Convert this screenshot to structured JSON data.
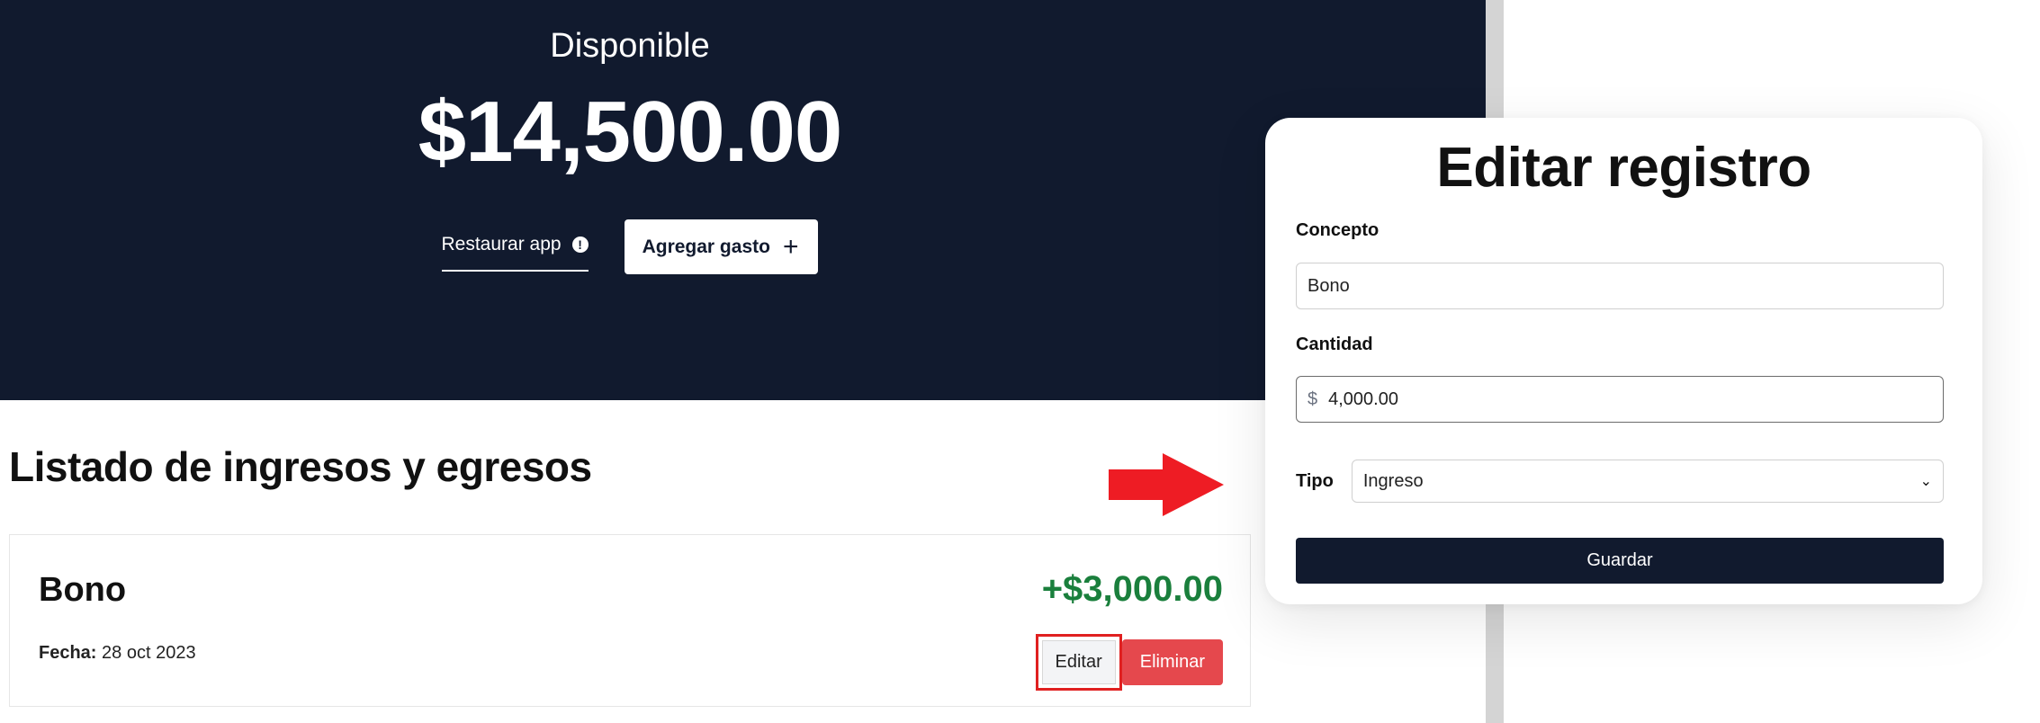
{
  "hero": {
    "label": "Disponible",
    "amount": "$14,500.00",
    "restore_label": "Restaurar app",
    "add_label": "Agregar gasto",
    "icons": {
      "restore": "alert-circle-icon",
      "add": "plus-icon"
    }
  },
  "list": {
    "title": "Listado de ingresos y egresos",
    "records": [
      {
        "concept": "Bono",
        "amount": "+$3,000.00",
        "date_label": "Fecha:",
        "date_value": "28 oct 2023",
        "edit_label": "Editar",
        "delete_label": "Eliminar"
      }
    ]
  },
  "modal": {
    "title": "Editar registro",
    "concept_label": "Concepto",
    "concept_value": "Bono",
    "amount_label": "Cantidad",
    "currency_symbol": "$",
    "amount_value": "4,000.00",
    "type_label": "Tipo",
    "type_value": "Ingreso",
    "save_label": "Guardar"
  },
  "colors": {
    "hero_bg": "#111a2e",
    "income_green": "#1a7f3c",
    "delete_red": "#e5484d",
    "highlight_red": "#e02020"
  }
}
